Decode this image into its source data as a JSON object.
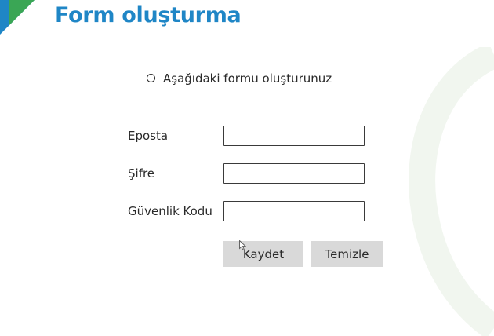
{
  "header": {
    "title": "Form oluşturma"
  },
  "instruction": {
    "bullet_icon": "circle-bullet-icon",
    "text": "Aşağıdaki formu oluşturunuz"
  },
  "form": {
    "email": {
      "label": "Eposta",
      "value": ""
    },
    "password": {
      "label": "Şifre",
      "value": ""
    },
    "security_code": {
      "label": "Güvenlik Kodu",
      "value": ""
    },
    "save_label": "Kaydet",
    "clear_label": "Temizle"
  },
  "colors": {
    "title": "#1f86c6",
    "corner_triangle_blue": "#1f86c6",
    "corner_triangle_green": "#3aa655",
    "button_bg": "#d9d9d9",
    "input_border": "#3a3a3a"
  }
}
